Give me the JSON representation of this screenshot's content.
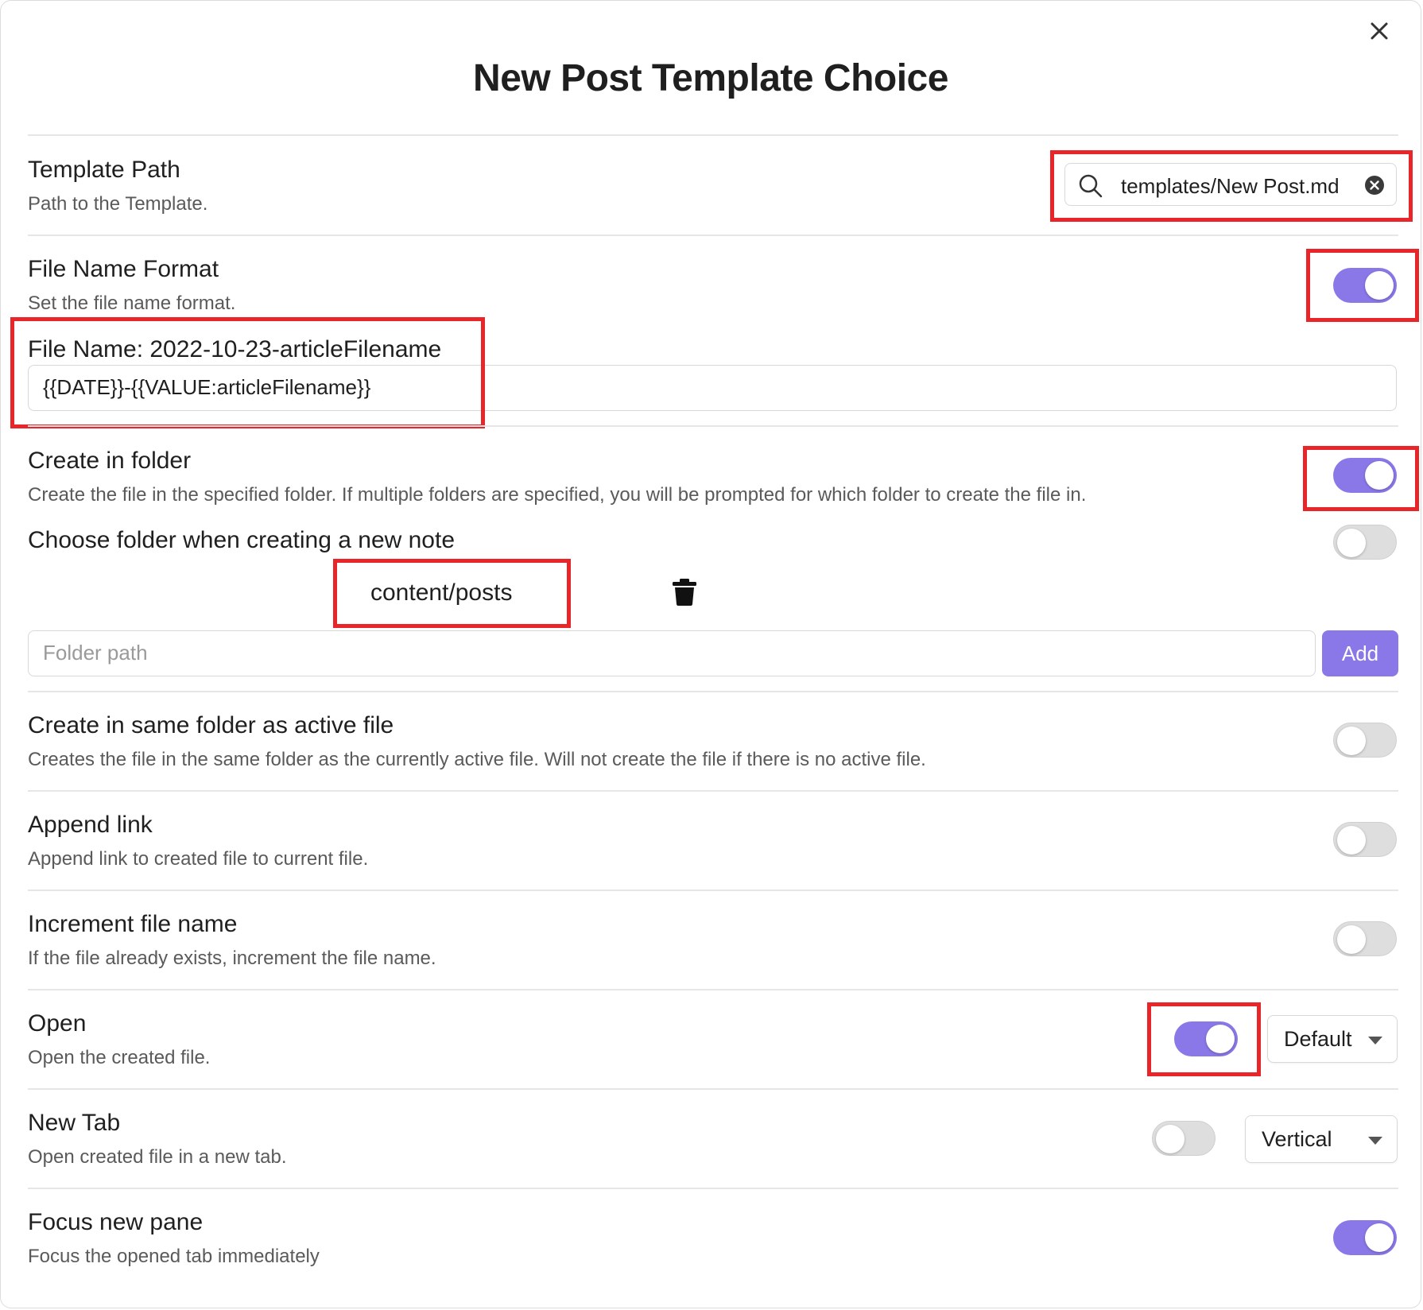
{
  "modal": {
    "title": "New Post Template Choice",
    "close_icon": "close-icon"
  },
  "template_path": {
    "name": "Template Path",
    "desc": "Path to the Template.",
    "value": "templates/New Post.md",
    "search_icon": "search-icon",
    "clear_icon": "clear-circle-icon"
  },
  "file_name_format": {
    "name": "File Name Format",
    "desc": "Set the file name format.",
    "enabled": true,
    "preview_label": "File Name: 2022-10-23-articleFilename",
    "format_value": "{{DATE}}-{{VALUE:articleFilename}}"
  },
  "create_in_folder": {
    "name": "Create in folder",
    "desc": "Create the file in the specified folder. If multiple folders are specified, you will be prompted for which folder to create the file in.",
    "enabled": true
  },
  "choose_folder": {
    "name": "Choose folder when creating a new note",
    "enabled": false,
    "folders": [
      "content/posts"
    ],
    "folder_path_placeholder": "Folder path",
    "add_label": "Add",
    "delete_icon": "trash-icon"
  },
  "same_folder": {
    "name": "Create in same folder as active file",
    "desc": "Creates the file in the same folder as the currently active file. Will not create the file if there is no active file.",
    "enabled": false
  },
  "append_link": {
    "name": "Append link",
    "desc": "Append link to created file to current file.",
    "enabled": false
  },
  "increment_file_name": {
    "name": "Increment file name",
    "desc": "If the file already exists, increment the file name.",
    "enabled": false
  },
  "open": {
    "name": "Open",
    "desc": "Open the created file.",
    "enabled": true,
    "mode": "Default"
  },
  "new_tab": {
    "name": "New Tab",
    "desc": "Open created file in a new tab.",
    "enabled": false,
    "direction": "Vertical"
  },
  "focus_new_pane": {
    "name": "Focus new pane",
    "desc": "Focus the opened tab immediately",
    "enabled": true
  },
  "colors": {
    "accent": "#8a78e8",
    "highlight": "#e8262a",
    "text": "#1f1f1f",
    "muted": "#5a5a5a"
  }
}
